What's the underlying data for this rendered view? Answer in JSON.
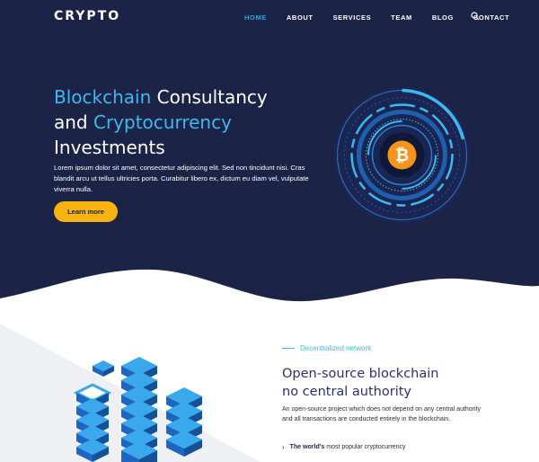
{
  "brand": {
    "logo_text": "CRYPTO"
  },
  "nav": {
    "items": [
      {
        "label": "HOME",
        "active": true
      },
      {
        "label": "ABOUT"
      },
      {
        "label": "SERVICES"
      },
      {
        "label": "TEAM"
      },
      {
        "label": "BLOG"
      },
      {
        "label": "CONTACT"
      }
    ],
    "search_icon": "search-icon"
  },
  "hero": {
    "title_line1_accent": "Blockchain",
    "title_line1_rest": " Consultancy",
    "title_line2_plain": "and ",
    "title_line2_accent": "Cryptocurrency",
    "title_line3": "Investments",
    "description": "Lorem ipsum dolor sit amet, consectetur adipiscing elit. Sed non tincidunt nisi. Cras blandit arcu ut tellus ultricies porta. Curabitur libero ex, dictum eu diam vel, vulputate viverra nulla.",
    "button_label": "Learn more",
    "emblem_icon": "bitcoin-icon"
  },
  "about": {
    "eyebrow": "Decentralized network",
    "title_line1": "Open-source blockchain",
    "title_line2": "no central authority",
    "description": "An open-source project which does not depend on any central authority and all transactions are conducted entirely in the blockchain.",
    "features": [
      {
        "bold": "The world's",
        "rest": " most popular cryptocurrency"
      }
    ]
  },
  "colors": {
    "hero_bg": "#1b2347",
    "accent_blue": "#3db8f0",
    "button_yellow": "#f6b311",
    "bitcoin_orange": "#f7931a",
    "title_navy": "#2b3070"
  }
}
